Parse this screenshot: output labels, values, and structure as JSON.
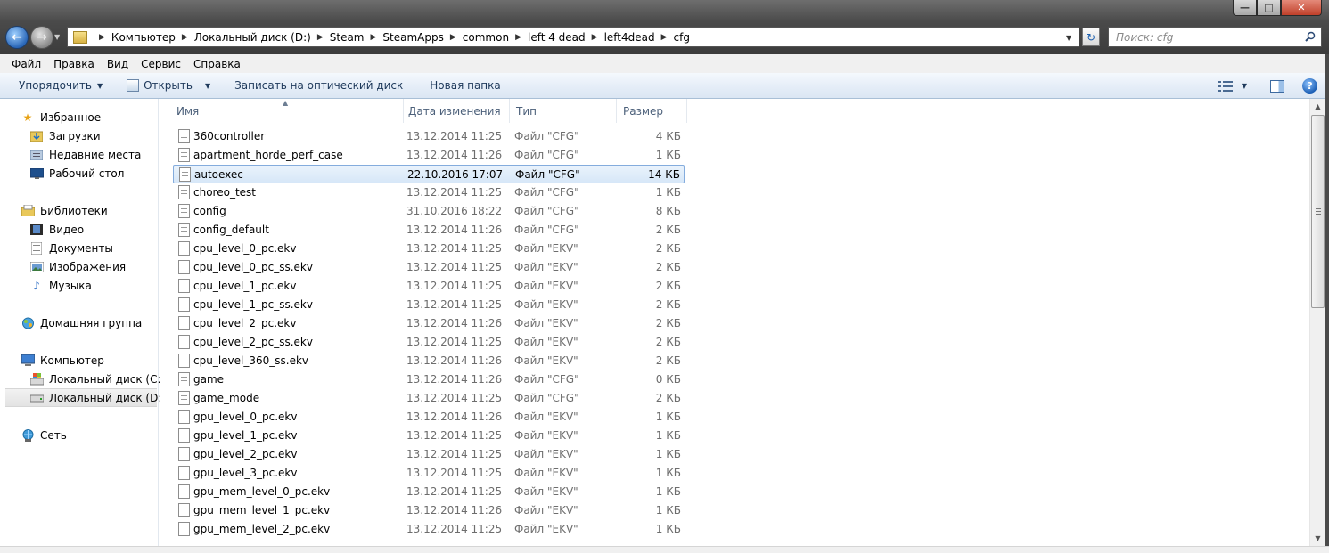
{
  "window": {
    "controls": {
      "minimize": "—",
      "maximize": "□",
      "close": "✕"
    }
  },
  "address": {
    "breadcrumbs": [
      "Компьютер",
      "Локальный диск (D:)",
      "Steam",
      "SteamApps",
      "common",
      "left 4 dead",
      "left4dead",
      "cfg"
    ],
    "search_placeholder": "Поиск: cfg"
  },
  "menu": [
    "Файл",
    "Правка",
    "Вид",
    "Сервис",
    "Справка"
  ],
  "toolbar": {
    "organize": "Упорядочить",
    "open": "Открыть",
    "burn": "Записать на оптический диск",
    "new_folder": "Новая папка"
  },
  "nav": {
    "favorites": "Избранное",
    "downloads": "Загрузки",
    "recent": "Недавние места",
    "desktop": "Рабочий стол",
    "libraries": "Библиотеки",
    "video": "Видео",
    "documents": "Документы",
    "images": "Изображения",
    "music": "Музыка",
    "homegroup": "Домашняя группа",
    "computer": "Компьютер",
    "disk_c": "Локальный диск (C:)",
    "disk_d": "Локальный диск (D:)",
    "network": "Сеть"
  },
  "columns": {
    "name": "Имя",
    "date": "Дата изменения",
    "type": "Тип",
    "size": "Размер"
  },
  "files": [
    {
      "name": "360controller",
      "date": "13.12.2014 11:25",
      "type": "Файл \"CFG\"",
      "size": "4 КБ"
    },
    {
      "name": "apartment_horde_perf_case",
      "date": "13.12.2014 11:26",
      "type": "Файл \"CFG\"",
      "size": "1 КБ"
    },
    {
      "name": "autoexec",
      "date": "22.10.2016 17:07",
      "type": "Файл \"CFG\"",
      "size": "14 КБ"
    },
    {
      "name": "choreo_test",
      "date": "13.12.2014 11:25",
      "type": "Файл \"CFG\"",
      "size": "1 КБ"
    },
    {
      "name": "config",
      "date": "31.10.2016 18:22",
      "type": "Файл \"CFG\"",
      "size": "8 КБ"
    },
    {
      "name": "config_default",
      "date": "13.12.2014 11:26",
      "type": "Файл \"CFG\"",
      "size": "2 КБ"
    },
    {
      "name": "cpu_level_0_pc.ekv",
      "date": "13.12.2014 11:25",
      "type": "Файл \"EKV\"",
      "size": "2 КБ"
    },
    {
      "name": "cpu_level_0_pc_ss.ekv",
      "date": "13.12.2014 11:25",
      "type": "Файл \"EKV\"",
      "size": "2 КБ"
    },
    {
      "name": "cpu_level_1_pc.ekv",
      "date": "13.12.2014 11:25",
      "type": "Файл \"EKV\"",
      "size": "2 КБ"
    },
    {
      "name": "cpu_level_1_pc_ss.ekv",
      "date": "13.12.2014 11:25",
      "type": "Файл \"EKV\"",
      "size": "2 КБ"
    },
    {
      "name": "cpu_level_2_pc.ekv",
      "date": "13.12.2014 11:26",
      "type": "Файл \"EKV\"",
      "size": "2 КБ"
    },
    {
      "name": "cpu_level_2_pc_ss.ekv",
      "date": "13.12.2014 11:25",
      "type": "Файл \"EKV\"",
      "size": "2 КБ"
    },
    {
      "name": "cpu_level_360_ss.ekv",
      "date": "13.12.2014 11:26",
      "type": "Файл \"EKV\"",
      "size": "2 КБ"
    },
    {
      "name": "game",
      "date": "13.12.2014 11:26",
      "type": "Файл \"CFG\"",
      "size": "0 КБ"
    },
    {
      "name": "game_mode",
      "date": "13.12.2014 11:25",
      "type": "Файл \"CFG\"",
      "size": "2 КБ"
    },
    {
      "name": "gpu_level_0_pc.ekv",
      "date": "13.12.2014 11:26",
      "type": "Файл \"EKV\"",
      "size": "1 КБ"
    },
    {
      "name": "gpu_level_1_pc.ekv",
      "date": "13.12.2014 11:25",
      "type": "Файл \"EKV\"",
      "size": "1 КБ"
    },
    {
      "name": "gpu_level_2_pc.ekv",
      "date": "13.12.2014 11:25",
      "type": "Файл \"EKV\"",
      "size": "1 КБ"
    },
    {
      "name": "gpu_level_3_pc.ekv",
      "date": "13.12.2014 11:25",
      "type": "Файл \"EKV\"",
      "size": "1 КБ"
    },
    {
      "name": "gpu_mem_level_0_pc.ekv",
      "date": "13.12.2014 11:25",
      "type": "Файл \"EKV\"",
      "size": "1 КБ"
    },
    {
      "name": "gpu_mem_level_1_pc.ekv",
      "date": "13.12.2014 11:26",
      "type": "Файл \"EKV\"",
      "size": "1 КБ"
    },
    {
      "name": "gpu_mem_level_2_pc.ekv",
      "date": "13.12.2014 11:25",
      "type": "Файл \"EKV\"",
      "size": "1 КБ"
    }
  ],
  "selected_file": "autoexec",
  "colors": {
    "selection_fill": "#d7e7f8",
    "selection_border": "#84acdd",
    "toolbar_text": "#1e395b"
  }
}
